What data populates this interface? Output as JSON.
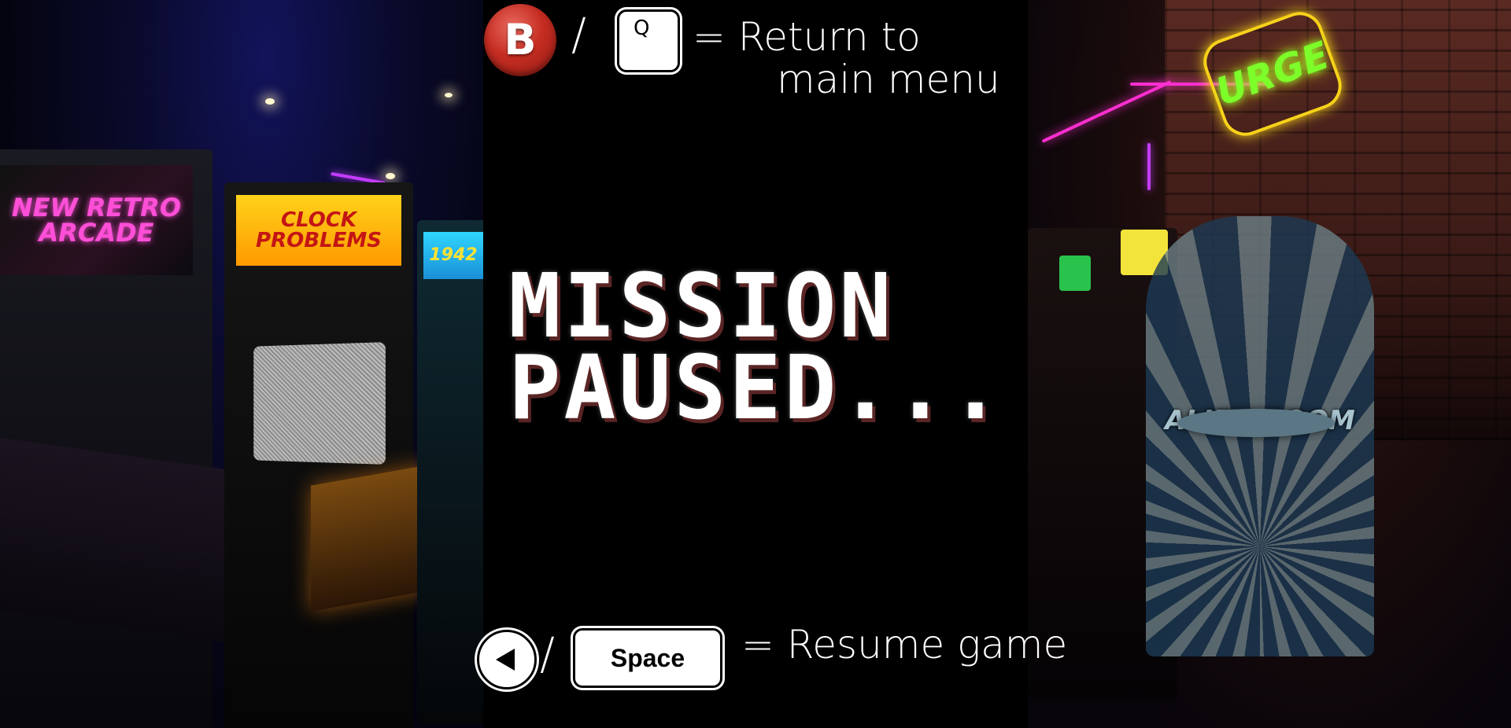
{
  "pause_screen": {
    "title_line1": "MISSION",
    "title_line2": "PAUSED...",
    "return_hint": {
      "gamepad_button": "B",
      "separator": "/",
      "keyboard_key": "Q",
      "label_line1": "= Return to",
      "label_line2": "main menu"
    },
    "resume_hint": {
      "gamepad_button": "back-arrow-icon",
      "separator": "/",
      "keyboard_key": "Space",
      "label": "= Resume game"
    }
  },
  "background_scene": {
    "left_marquees": [
      "NEW RETRO ARCADE",
      "CLOCK PROBLEMS",
      "1942"
    ],
    "right_signs": [
      "URGE",
      "ALIEN BOOM"
    ],
    "colors": {
      "b_button": "#c62d22",
      "neon_pink": "#ff2fd0",
      "neon_green": "#7dff2a",
      "title_shadow": "#5b2525"
    }
  }
}
